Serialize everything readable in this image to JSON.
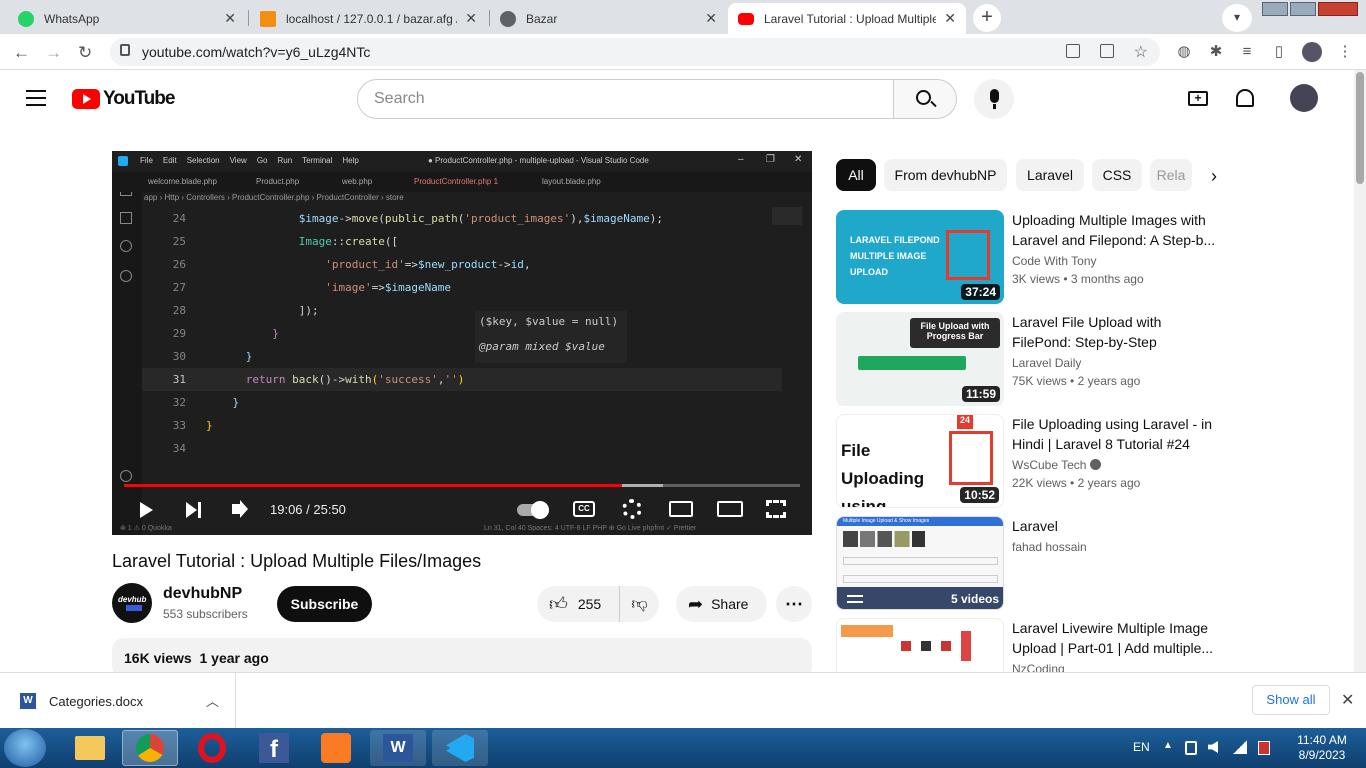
{
  "browser": {
    "tabs": [
      {
        "label": "WhatsApp",
        "icon": "whatsapp-icon",
        "color": "#25d366",
        "active": false
      },
      {
        "label": "localhost / 127.0.0.1 / bazar.afg /",
        "icon": "phpmyadmin-icon",
        "color": "#f29111",
        "active": false
      },
      {
        "label": "Bazar",
        "icon": "globe-icon",
        "color": "#5f6368",
        "active": false
      },
      {
        "label": "Laravel Tutorial : Upload Multiple",
        "icon": "youtube-icon",
        "color": "#ff0000",
        "active": true
      }
    ],
    "close_glyph": "✕",
    "new_tab_glyph": "+",
    "url": "youtube.com/watch?v=y6_uLzg4NTc"
  },
  "yt_header": {
    "logo_text": "YouTube",
    "search_placeholder": "Search"
  },
  "player": {
    "vscode": {
      "menu": [
        "File",
        "Edit",
        "Selection",
        "View",
        "Go",
        "Run",
        "Terminal",
        "Help"
      ],
      "window_title": "● ProductController.php - multiple-upload - Visual Studio Code",
      "tabs": [
        "welcome.blade.php",
        "Product.php",
        "web.php",
        "ProductController.php 1",
        "layout.blade.php"
      ],
      "breadcrumb": "app › Http › Controllers › ProductController.php › ProductController › store",
      "line_numbers": [
        "24",
        "25",
        "26",
        "27",
        "28",
        "29",
        "30",
        "31",
        "32",
        "33",
        "34"
      ],
      "hover_signature": "($key, $value = null)",
      "hover_param": "@param mixed $value",
      "status_left": "⊗ 1 ⚠ 0    Quokka",
      "status_right": "Ln 31, Col 40   Spaces: 4   UTF-8   LF   PHP   ⊕ Go Live   phpfmt   ✓ Prettier"
    },
    "time": "19:06 / 25:50",
    "progress_fraction": 0.737
  },
  "video": {
    "title": "Laravel Tutorial : Upload Multiple Files/Images",
    "channel": "devhubNP",
    "subscribers": "553 subscribers",
    "subscribe_label": "Subscribe",
    "likes": "255",
    "share_label": "Share",
    "views": "16K views",
    "age": "1 year ago"
  },
  "chips": [
    "All",
    "From devhubNP",
    "Laravel",
    "CSS",
    "Rela"
  ],
  "recommendations": [
    {
      "title": "Uploading Multiple Images with Laravel and Filepond: A Step-b...",
      "channel": "Code With Tony",
      "views": "3K views",
      "age": "3 months ago",
      "duration": "37:24",
      "thumb_text": "LARAVEL FILEPOND MULTIPLE IMAGE UPLOAD"
    },
    {
      "title": "Laravel File Upload with FilePond: Step-by-Step",
      "channel": "Laravel Daily",
      "views": "75K views",
      "age": "2 years ago",
      "duration": "11:59",
      "thumb_text": "File Upload with Progress Bar"
    },
    {
      "title": "File Uploading using Laravel - in Hindi | Laravel 8 Tutorial #24",
      "channel": "WsCube Tech",
      "views": "22K views",
      "age": "2 years ago",
      "duration": "10:52",
      "thumb_text": "File Uploading using Laravel"
    },
    {
      "title": "Laravel",
      "channel": "fahad hossain",
      "views": "",
      "age": "",
      "duration": "5 videos",
      "thumb_text": "Multiple Image Upload & Show Images"
    },
    {
      "title": "Laravel Livewire Multiple Image Upload | Part-01 | Add multiple...",
      "channel": "NzCoding",
      "views": "",
      "age": "",
      "duration": "",
      "thumb_text": ""
    }
  ],
  "download": {
    "file": "Categories.docx",
    "show_all": "Show all"
  },
  "taskbar": {
    "lang": "EN",
    "time": "11:40 AM",
    "date": "8/9/2023"
  }
}
